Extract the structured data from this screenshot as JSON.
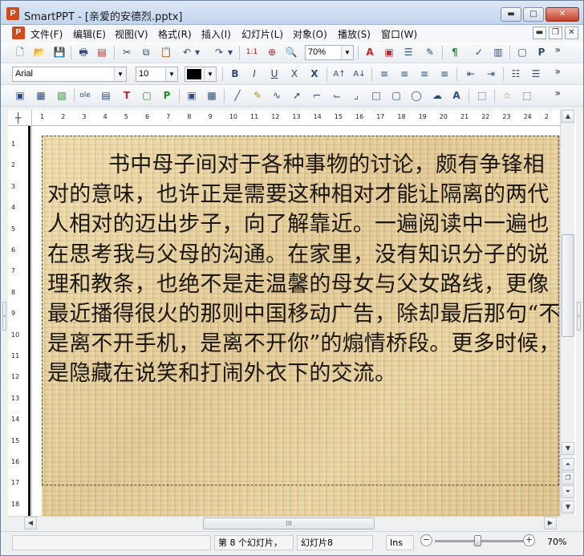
{
  "window": {
    "app_icon": "P",
    "title": "SmartPPT - [亲爱的安德烈.pptx]",
    "minimize_icon": "▬",
    "maximize_icon": "□",
    "close_icon": "✕"
  },
  "menubar": {
    "logo": "P",
    "items": [
      "文件(F)",
      "编辑(E)",
      "视图(V)",
      "格式(R)",
      "插入(I)",
      "幻灯片(L)",
      "对象(O)",
      "播放(S)",
      "窗口(W)"
    ],
    "mdi_minimize": "▬",
    "mdi_restore": "❐",
    "mdi_close": "✕"
  },
  "toolbar1": {
    "icons": {
      "new": "🗋",
      "open": "📂",
      "save": "💾",
      "print": "🖶",
      "pdf": "▤",
      "cut": "✂",
      "copy": "⧉",
      "paste": "📋",
      "undo": "↶",
      "undo_drop": "▾",
      "redo": "↷",
      "redo_drop": "▾",
      "slide_size": "1:1",
      "zoom_tool": "⊕",
      "find": "🔍",
      "text_color": "A",
      "sheet": "▣",
      "list": "☰",
      "brush": "✎",
      "pilcrow": "¶",
      "spell": "✓",
      "chart": "▥",
      "frame1": "▢",
      "frame2": "P"
    },
    "zoom_value": "70%",
    "more": "»"
  },
  "toolbar2": {
    "font_name": "Arial",
    "font_size": "10",
    "icons": {
      "bold": "B",
      "italic": "I",
      "underline": "U",
      "strike": "X",
      "strike2": "X",
      "grow": "A↑",
      "shrink": "A↓",
      "align_left": "≡",
      "align_center": "≡",
      "align_right": "≡",
      "justify": "≡",
      "outdent": "⇤",
      "indent": "⇥",
      "bullets": "☷",
      "numbering": "☰"
    },
    "more": "»"
  },
  "toolbar3": {
    "icons": {
      "t1": "▣",
      "t2": "▦",
      "t3": "▧",
      "t4": "ole",
      "t5": "▤",
      "t6": "T",
      "t7": "▢",
      "t8": "P",
      "t9": "▣",
      "t10": "▩",
      "line": "╱",
      "pen": "✎",
      "curve": "∿",
      "arrow": "➚",
      "conn1": "⌐",
      "conn2": "⌙",
      "conn3": "⌟",
      "rect": "□",
      "round": "▢",
      "ellipse": "◯",
      "shape": "☁",
      "wordart": "A",
      "group": "⬚",
      "star": "☆",
      "more_shapes": "⬚"
    },
    "more": "»"
  },
  "ruler": {
    "h_numbers": [
      "1",
      "2",
      "3",
      "4",
      "5",
      "6",
      "7",
      "8",
      "9",
      "10",
      "11",
      "12",
      "13",
      "14",
      "15",
      "16",
      "17",
      "18",
      "19",
      "20",
      "21",
      "22",
      "23",
      "24",
      "2"
    ],
    "v_numbers": [
      "1",
      "2",
      "3",
      "4",
      "5",
      "6",
      "7",
      "8",
      "9",
      "10",
      "11",
      "12",
      "13",
      "14",
      "15",
      "16",
      "17",
      "18"
    ]
  },
  "slide": {
    "text": "书中母子间对于各种事物的讨论，颇有争锋相对的意味，也许正是需要这种相对才能让隔离的两代人相对的迈出步子，向了解靠近。一遍阅读中一遍也在思考我与父母的沟通。在家里，没有知识分子的说理和教条，也绝不是走温馨的母女与父女路线，更像最近播得很火的那则中国移动广告，除却最后那句“不是离不开手机，是离不开你”的煽情桥段。更多时候，是隐藏在说笑和打闹外衣下的交流。"
  },
  "scroll": {
    "up": "▲",
    "down": "▼",
    "left": "◀",
    "right": "▶",
    "page_up": "⏶",
    "page_down": "⏷",
    "side": "❐",
    "hthumb_grip": "III"
  },
  "status": {
    "slide_info": "第 8 个幻灯片，",
    "slide_name": "幻灯片8",
    "mode": "Ins",
    "zoom_minus": "−",
    "zoom_plus": "+",
    "zoom": "70%",
    "zoom_level": 0.45
  },
  "side_grips": {
    "left": "‹",
    "right": "›"
  }
}
